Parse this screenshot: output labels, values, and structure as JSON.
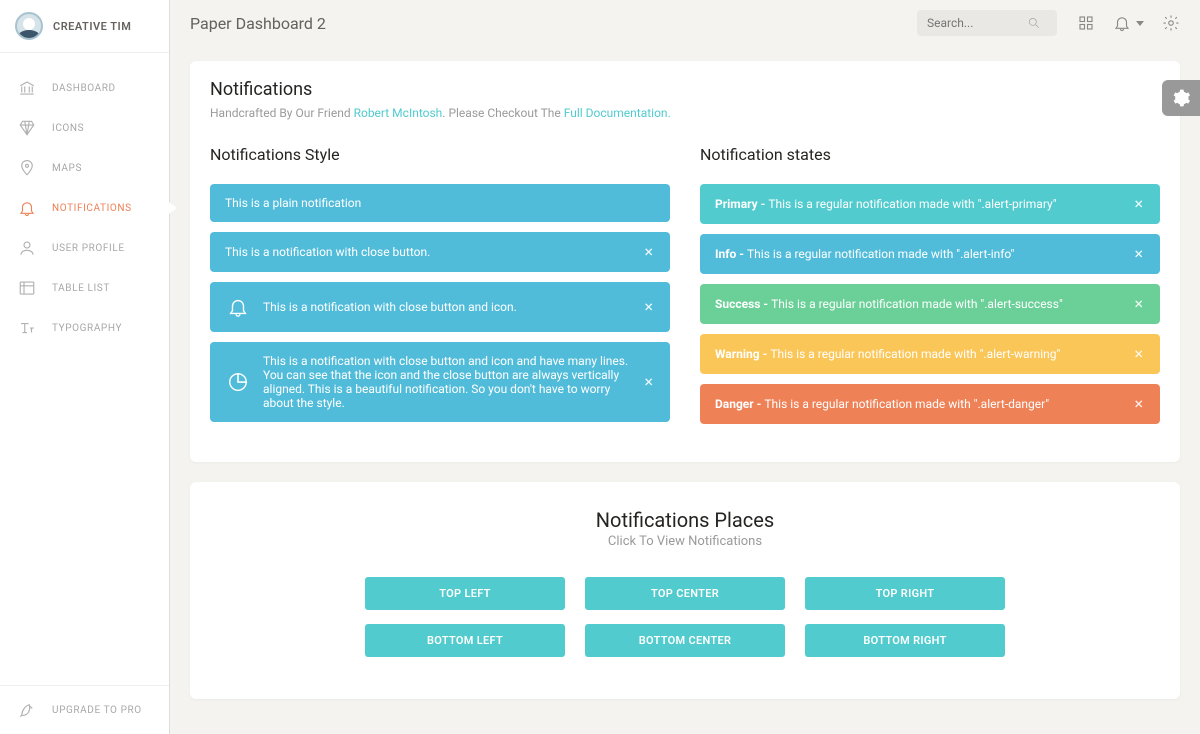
{
  "brand": "CREATIVE TIM",
  "panel_title": "Paper Dashboard 2",
  "search_placeholder": "Search...",
  "sidebar": {
    "items": [
      {
        "label": "DASHBOARD"
      },
      {
        "label": "ICONS"
      },
      {
        "label": "MAPS"
      },
      {
        "label": "NOTIFICATIONS"
      },
      {
        "label": "USER PROFILE"
      },
      {
        "label": "TABLE LIST"
      },
      {
        "label": "TYPOGRAPHY"
      }
    ],
    "footer": {
      "label": "UPGRADE TO PRO"
    }
  },
  "header": {
    "title": "Notifications",
    "sub_pre": "Handcrafted By Our Friend ",
    "sub_link1": "Robert McIntosh",
    "sub_mid": ". Please Checkout The ",
    "sub_link2": "Full Documentation.",
    "col1_title": "Notifications Style",
    "col2_title": "Notification states"
  },
  "style_alerts": {
    "a1": "This is a plain notification",
    "a2": "This is a notification with close button.",
    "a3": "This is a notification with close button and icon.",
    "a4": "This is a notification with close button and icon and have many lines. You can see that the icon and the close button are always vertically aligned. This is a beautiful notification. So you don't have to worry about the style."
  },
  "state_alerts": {
    "primary": {
      "b": "Primary - ",
      "t": "This is a regular notification made with \".alert-primary\""
    },
    "info": {
      "b": "Info - ",
      "t": "This is a regular notification made with \".alert-info\""
    },
    "success": {
      "b": "Success - ",
      "t": "This is a regular notification made with \".alert-success\""
    },
    "warning": {
      "b": "Warning - ",
      "t": "This is a regular notification made with \".alert-warning\""
    },
    "danger": {
      "b": "Danger - ",
      "t": "This is a regular notification made with \".alert-danger\""
    }
  },
  "places": {
    "title": "Notifications Places",
    "sub": "Click To View Notifications",
    "buttons": {
      "tl": "TOP LEFT",
      "tc": "TOP CENTER",
      "tr": "TOP RIGHT",
      "bl": "BOTTOM LEFT",
      "bc": "BOTTOM CENTER",
      "br": "BOTTOM RIGHT"
    }
  }
}
